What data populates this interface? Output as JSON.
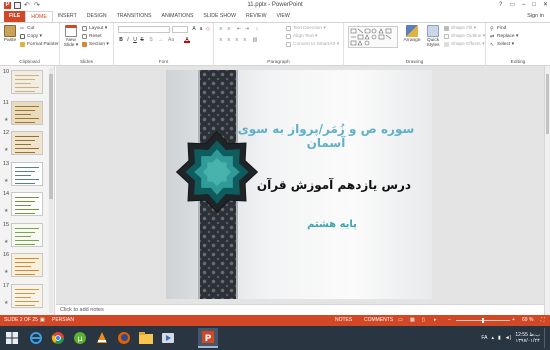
{
  "window": {
    "title": "11.pptx - PowerPoint",
    "controls": [
      "?",
      "▭",
      "–",
      "□",
      "✕"
    ]
  },
  "ribbon_tabs": [
    "FILE",
    "HOME",
    "INSERT",
    "DESIGN",
    "TRANSITIONS",
    "ANIMATIONS",
    "SLIDE SHOW",
    "REVIEW",
    "VIEW"
  ],
  "signin": "Sign in",
  "clipboard": {
    "paste": "Paste",
    "cut": "Cut",
    "copy": "Copy ▾",
    "format_painter": "Format Painter",
    "label": "Clipboard"
  },
  "slides_group": {
    "new_slide": "New Slide ▾",
    "layout": "Layout ▾",
    "reset": "Reset",
    "section": "Section ▾",
    "label": "Slides"
  },
  "font_group": {
    "bold": "B",
    "italic": "I",
    "underline": "U",
    "strike": "S",
    "label": "Font"
  },
  "paragraph_group": {
    "text_direction": "Text Direction ▾",
    "align_text": "Align Text ▾",
    "smartart": "Convert to SmartArt ▾",
    "label": "Paragraph"
  },
  "drawing_group": {
    "arrange": "Arrange",
    "quick_styles": "Quick Styles",
    "shape_fill": "Shape Fill ▾",
    "shape_outline": "Shape Outline ▾",
    "shape_effects": "Shape Effects ▾",
    "label": "Drawing"
  },
  "editing_group": {
    "find": "Find",
    "replace": "Replace ▾",
    "select": "Select ▾",
    "label": "Editing"
  },
  "thumbnails": [
    {
      "num": "10",
      "star": "",
      "palette": [
        "#f3eee4",
        "#c9b27f"
      ]
    },
    {
      "num": "11",
      "star": "★",
      "palette": [
        "#e9dcbc",
        "#a1732e"
      ]
    },
    {
      "num": "12",
      "star": "★",
      "palette": [
        "#efe5cf",
        "#9b6e2d"
      ]
    },
    {
      "num": "13",
      "star": "★",
      "palette": [
        "#ffffff",
        "#5879b8"
      ]
    },
    {
      "num": "14",
      "star": "★",
      "palette": [
        "#ffffff",
        "#6a9a3c"
      ]
    },
    {
      "num": "15",
      "star": "★",
      "palette": [
        "#f7f9f3",
        "#7ea34e"
      ]
    },
    {
      "num": "16",
      "star": "★",
      "palette": [
        "#f9f0dc",
        "#d08b39"
      ]
    },
    {
      "num": "17",
      "star": "★",
      "palette": [
        "#f8f3e8",
        "#cc9949"
      ]
    }
  ],
  "slide": {
    "line1": "سوره ص و زُمَر/پرواز به سوی آسمان",
    "line2": "درس یازدهم آموزش قرآن",
    "line3": "پایه هشتم"
  },
  "notes_placeholder": "Click to add notes",
  "status": {
    "slide_count": "SLIDE 2 OF 25",
    "language": "PERSIAN",
    "notes": "NOTES",
    "comments": "COMMENTS",
    "zoom": "69 %"
  },
  "taskbar": {
    "lang": "FA",
    "time": "12:55 ب.ظ",
    "date": "۱۳۹۷/۰۱/۲۴",
    "apps": [
      "start",
      "ie",
      "chrome",
      "utorrent",
      "vlc",
      "firefox",
      "explorer",
      "media",
      "powerpoint"
    ]
  },
  "colors": {
    "accent": "#d24726",
    "taskbar": "#2a3542",
    "slide_title": "#5fb0c8",
    "slide_subtitle": "#3aa7b3"
  }
}
